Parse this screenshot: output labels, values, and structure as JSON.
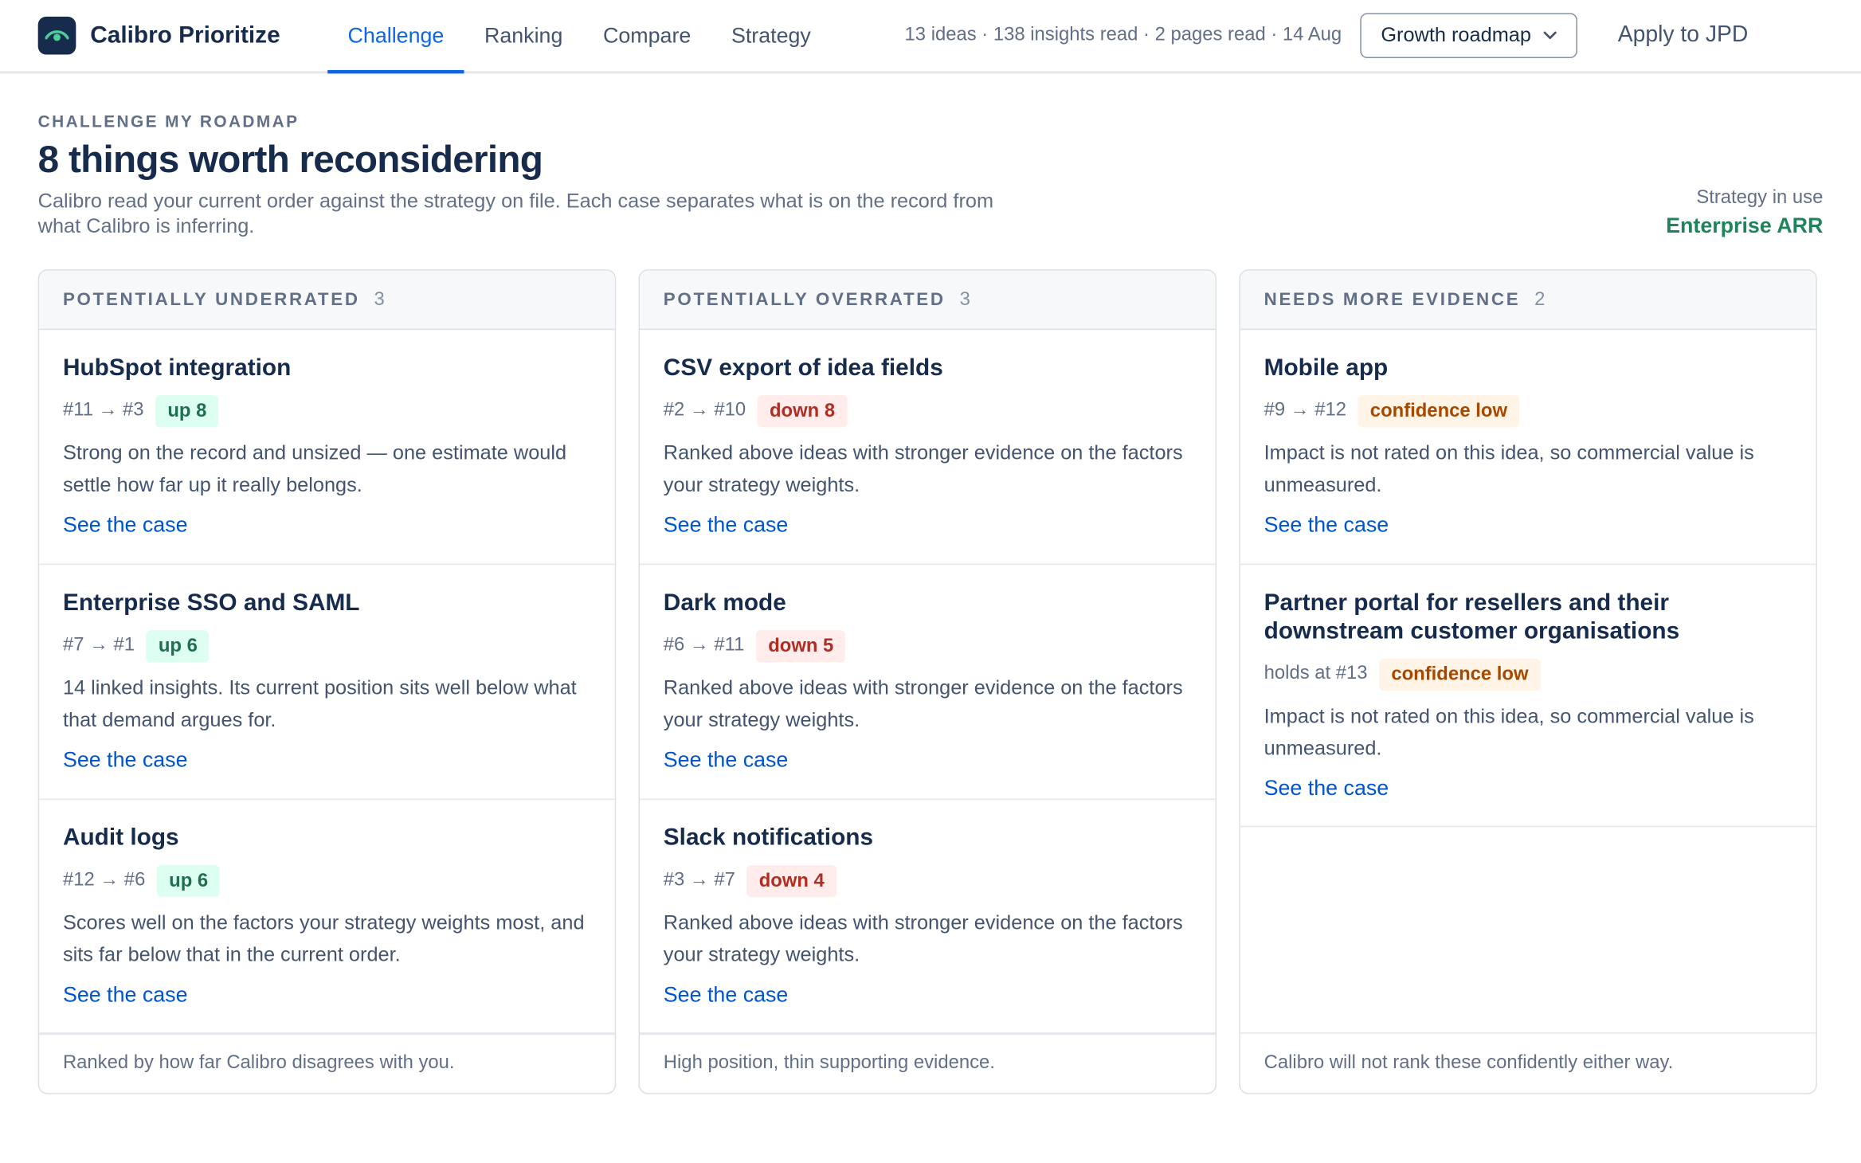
{
  "app": {
    "name": "Calibro Prioritize",
    "logo_icon": "eye-icon"
  },
  "nav": {
    "tabs": [
      {
        "label": "Challenge",
        "active": true
      },
      {
        "label": "Ranking",
        "active": false
      },
      {
        "label": "Compare",
        "active": false
      },
      {
        "label": "Strategy",
        "active": false
      }
    ],
    "meta": "13 ideas · 138 insights read · 2 pages read · 14 Aug",
    "roadmap_select": "Growth roadmap",
    "apply_label": "Apply to JPD"
  },
  "header": {
    "eyebrow": "CHALLENGE MY ROADMAP",
    "title": "8 things worth reconsidering",
    "description": "Calibro read your current order against the strategy on file. Each case separates what is on the record from what Calibro is inferring.",
    "strategy_label": "Strategy in use",
    "strategy_value": "Enterprise ARR"
  },
  "columns": [
    {
      "title": "POTENTIALLY UNDERRATED",
      "count": "3",
      "footer": "Ranked by how far Calibro disagrees with you.",
      "cards": [
        {
          "title": "HubSpot integration",
          "rank": "#11 → #3",
          "badge": "up 8",
          "badge_type": "up",
          "text": "Strong on the record and unsized — one estimate would settle how far up it really belongs.",
          "link": "See the case"
        },
        {
          "title": "Enterprise SSO and SAML",
          "rank": "#7 → #1",
          "badge": "up 6",
          "badge_type": "up",
          "text": "14 linked insights. Its current position sits well below what that demand argues for.",
          "link": "See the case"
        },
        {
          "title": "Audit logs",
          "rank": "#12 → #6",
          "badge": "up 6",
          "badge_type": "up",
          "text": "Scores well on the factors your strategy weights most, and sits far below that in the current order.",
          "link": "See the case"
        }
      ]
    },
    {
      "title": "POTENTIALLY OVERRATED",
      "count": "3",
      "footer": "High position, thin supporting evidence.",
      "cards": [
        {
          "title": "CSV export of idea fields",
          "rank": "#2 → #10",
          "badge": "down 8",
          "badge_type": "down",
          "text": "Ranked above ideas with stronger evidence on the factors your strategy weights.",
          "link": "See the case"
        },
        {
          "title": "Dark mode",
          "rank": "#6 → #11",
          "badge": "down 5",
          "badge_type": "down",
          "text": "Ranked above ideas with stronger evidence on the factors your strategy weights.",
          "link": "See the case"
        },
        {
          "title": "Slack notifications",
          "rank": "#3 → #7",
          "badge": "down 4",
          "badge_type": "down",
          "text": "Ranked above ideas with stronger evidence on the factors your strategy weights.",
          "link": "See the case"
        }
      ]
    },
    {
      "title": "NEEDS MORE EVIDENCE",
      "count": "2",
      "footer": "Calibro will not rank these confidently either way.",
      "cards": [
        {
          "title": "Mobile app",
          "rank": "#9 → #12",
          "badge": "confidence low",
          "badge_type": "low",
          "text": "Impact is not rated on this idea, so commercial value is unmeasured.",
          "link": "See the case"
        },
        {
          "title": "Partner portal for resellers and their downstream customer organisations",
          "rank": "holds at #13",
          "badge": "confidence low",
          "badge_type": "low",
          "text": "Impact is not rated on this idea, so commercial value is unmeasured.",
          "link": "See the case"
        }
      ]
    }
  ],
  "colors": {
    "accent": "#0c66e4",
    "link": "#0055cc",
    "strategy": "#1f845a",
    "up": "#216e4e",
    "down": "#ae2e24",
    "low": "#a54800"
  }
}
